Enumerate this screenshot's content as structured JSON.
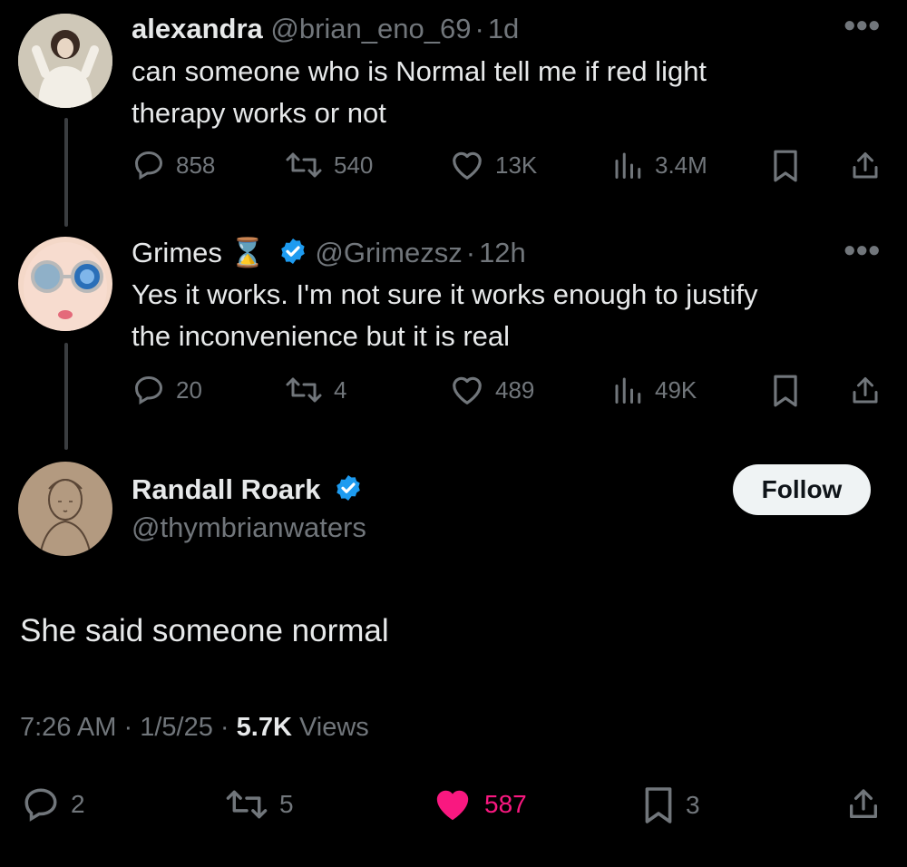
{
  "tweets": [
    {
      "name": "alexandra",
      "handle": "@brian_eno_69",
      "sep": "·",
      "time": "1d",
      "text_line1": "can someone who is Normal tell me if red light",
      "text_line2": "therapy works or not",
      "replies": "858",
      "retweets": "540",
      "likes": "13K",
      "views": "3.4M"
    },
    {
      "name": "Grimes",
      "emoji": "⌛",
      "handle": "@Grimezsz",
      "sep": "·",
      "time": "12h",
      "text_line1": "Yes it works.  I'm not sure it works enough to justify",
      "text_line2": "the inconvenience but it is real",
      "replies": "20",
      "retweets": "4",
      "likes": "489",
      "views": "49K"
    }
  ],
  "main_post": {
    "name": "Randall Roark",
    "handle": "@thymbrianwaters",
    "follow_label": "Follow",
    "text": "She said someone normal",
    "time": "7:26 AM",
    "date": "1/5/25",
    "sep": "·",
    "views_count": "5.7K",
    "views_label": "Views",
    "replies": "2",
    "retweets": "5",
    "likes": "587",
    "bookmarks": "3"
  },
  "colors": {
    "background": "#000000",
    "text": "#e7e9ea",
    "muted": "#71767b",
    "verified": "#1d9bf0",
    "like_active": "#f91880",
    "follow_bg": "#eff3f4"
  },
  "icons": [
    "reply-icon",
    "retweet-icon",
    "like-icon",
    "views-icon",
    "bookmark-icon",
    "share-icon",
    "verified-icon",
    "more-icon"
  ]
}
